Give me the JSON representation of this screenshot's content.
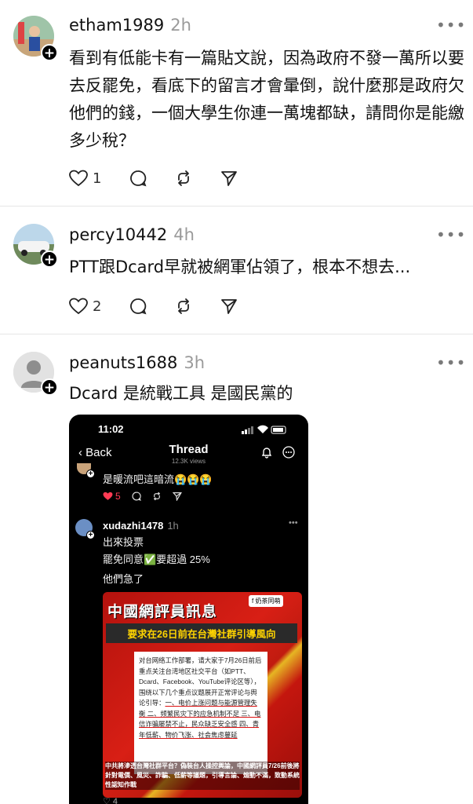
{
  "posts": [
    {
      "username": "etham1989",
      "time": "2h",
      "text": "看到有低能卡有一篇貼文說，因為政府不發一萬所以要去反罷免，看底下的留言才會暈倒，說什麼那是政府欠他們的錢，一個大學生你連一萬塊都缺，請問你是能繳多少稅？",
      "likes": "1"
    },
    {
      "username": "percy10442",
      "time": "4h",
      "text": "PTT跟Dcard早就被網軍佔領了，根本不想去...",
      "likes": "2"
    },
    {
      "username": "peanuts1688",
      "time": "3h",
      "text": "Dcard 是統戰工具 是國民黨的"
    }
  ],
  "screenshot": {
    "status_time": "11:02",
    "back_label": "Back",
    "title": "Thread",
    "views": "12.3K views",
    "prev_reply_text": "是暖流吧這暗流😭😭😭",
    "prev_reply_likes": "5",
    "reply_username": "xudazhi1478",
    "reply_time": "1h",
    "reply_lines": [
      "出來投票",
      "罷免同意✅要超過 25%",
      "他們急了"
    ],
    "news": {
      "headline": "中國網評員訊息",
      "badge": "f 奶茶同萌",
      "subheadline": "要求在26日前在台灣社群引導風向",
      "notice_intro": "对台网络工作部署，请大家于7月26日前后重点关注台湾地区社交平台（如PTT、Dcard、Facebook、YouTube评论区等），围绕以下几个重点议题展开正常评论与舆论引导：",
      "notice_points": "一、电价上涨问题与能源管理失衡 二、频繁民灾下的应急机制不足 三、电信诈骗屡禁不止，民众缺乏安全感 四、青年低薪、物价飞涨、社会焦虑蔓延",
      "caption": "中共將滲透台灣社群平台？偽裝台人操控輿論，中國網評員7/26前後將針對電價、風災、詐騙、低薪等議題，引導言論、煽動不滿，致動系統性認知作戰"
    },
    "bottom_likes": "4"
  }
}
